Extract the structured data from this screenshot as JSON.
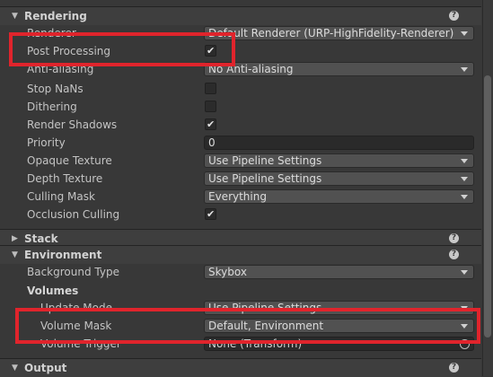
{
  "sections": {
    "rendering": {
      "title": "Rendering",
      "help_icon": "?"
    },
    "stack": {
      "title": "Stack",
      "help_icon": "?"
    },
    "environment": {
      "title": "Environment",
      "help_icon": "?"
    },
    "output": {
      "title": "Output",
      "help_icon": "?"
    }
  },
  "rendering": {
    "renderer": {
      "label": "Renderer",
      "value": "Default Renderer (URP-HighFidelity-Renderer)"
    },
    "post_processing": {
      "label": "Post Processing",
      "checked": true
    },
    "anti_aliasing": {
      "label": "Anti-aliasing",
      "value": "No Anti-aliasing"
    },
    "stop_nans": {
      "label": "Stop NaNs",
      "checked": false
    },
    "dithering": {
      "label": "Dithering",
      "checked": false
    },
    "render_shadows": {
      "label": "Render Shadows",
      "checked": true
    },
    "priority": {
      "label": "Priority",
      "value": "0"
    },
    "opaque_texture": {
      "label": "Opaque Texture",
      "value": "Use Pipeline Settings"
    },
    "depth_texture": {
      "label": "Depth Texture",
      "value": "Use Pipeline Settings"
    },
    "culling_mask": {
      "label": "Culling Mask",
      "value": "Everything"
    },
    "occlusion_culling": {
      "label": "Occlusion Culling",
      "checked": true
    }
  },
  "environment": {
    "background_type": {
      "label": "Background Type",
      "value": "Skybox"
    },
    "volumes_label": "Volumes",
    "update_mode": {
      "label": "Update Mode",
      "value": "Use Pipeline Settings"
    },
    "volume_mask": {
      "label": "Volume Mask",
      "value": "Default, Environment"
    },
    "volume_trigger": {
      "label": "Volume Trigger",
      "value": "None (Transform)"
    }
  },
  "highlight_color": "#e0242c"
}
